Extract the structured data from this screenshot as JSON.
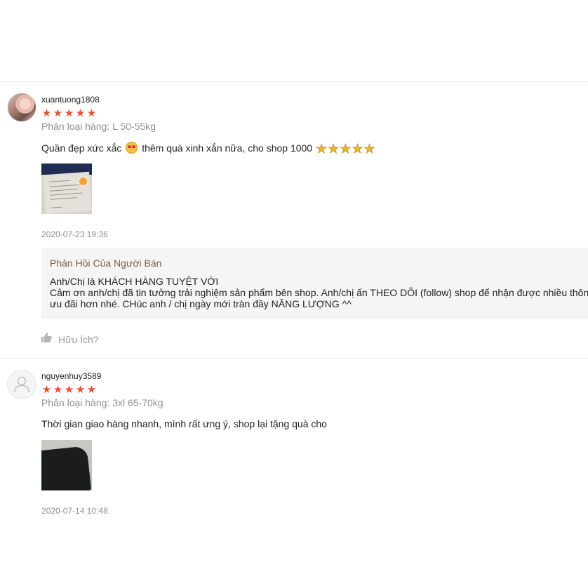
{
  "reviews": [
    {
      "username": "xuantuong1808",
      "rating": 5,
      "variant": "Phân loại hàng: L 50-55kg",
      "comment_part1": "Quần đẹp xức xắc",
      "comment_part2": "thêm quà xinh xắn nữa, cho shop 1000",
      "emoji_icon": "heart-eyes-emoji-icon",
      "gold_star_icon": "gold-star-emoji-icon",
      "gold_star_count": 5,
      "timestamp": "2020-07-23 19:36",
      "reply": {
        "title": "Phản Hồi Của Người Bán",
        "line1": "Anh/Chị là KHÁCH HÀNG TUYỆT VỜI",
        "line2": "Cảm ơn anh/chị đã tin tưởng trải nghiệm sản phẩm bên shop. Anh/chị ấn THEO DÕI (follow) shop để nhận được nhiều thông",
        "line3": "ưu đãi hơn nhé. CHúc anh / chị ngày mới tràn đầy NĂNG LƯỢNG ^^"
      },
      "helpful_label": "Hữu Ích?"
    },
    {
      "username": "nguyenhuy3589",
      "rating": 5,
      "variant": "Phân loại hàng: 3xl 65-70kg",
      "comment": "Thời gian giao hàng nhanh, mình rất ưng ý, shop lại  tặng quà cho",
      "timestamp": "2020-07-14 10:48"
    }
  ],
  "colors": {
    "rating_star": "#ee4d2d",
    "reply_bg": "#f5f5f5",
    "reply_title": "#7a5d42",
    "muted": "#8f8f8f"
  }
}
